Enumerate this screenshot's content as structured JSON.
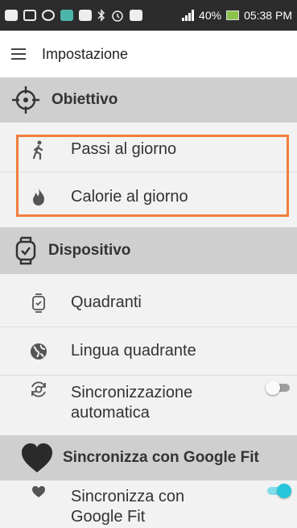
{
  "status_bar": {
    "battery": "40%",
    "time": "05:38 PM",
    "icons": [
      "chat-icon",
      "photo-icon",
      "sync-icon",
      "image-icon",
      "mail-icon",
      "bluetooth-icon",
      "alarm-icon",
      "network-icon",
      "signal-icon",
      "battery-icon"
    ]
  },
  "toolbar": {
    "title": "Impostazione"
  },
  "sections": {
    "objective": {
      "title": "Obiettivo",
      "items": [
        {
          "label": "Passi al giorno"
        },
        {
          "label": "Calorie al giorno"
        }
      ]
    },
    "device": {
      "title": "Dispositivo",
      "items": [
        {
          "label": "Quadranti"
        },
        {
          "label": "Lingua quadrante"
        }
      ],
      "auto_sync": {
        "label_line1": "Sincronizzazione",
        "label_line2": "automatica",
        "enabled": false
      }
    },
    "google_fit": {
      "title": "Sincronizza con Google Fit",
      "sync": {
        "label_line1": "Sincronizza con",
        "label_line2": "Google Fit",
        "enabled": true
      }
    }
  },
  "colors": {
    "accent": "#26c6da",
    "highlight": "#f07f3c",
    "header_bg": "#cfcfcf"
  }
}
